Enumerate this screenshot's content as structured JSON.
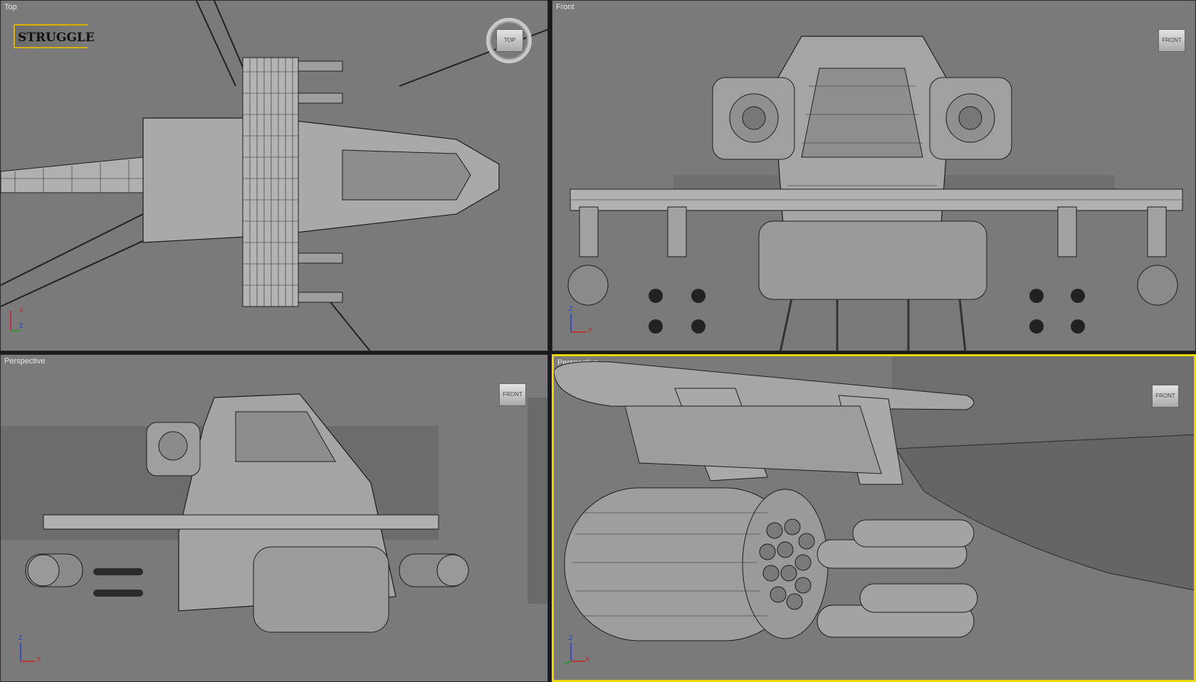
{
  "viewports": {
    "top": {
      "label": "Top"
    },
    "front": {
      "label": "Front"
    },
    "perspective": {
      "label": "Perspective"
    },
    "camera": {
      "label": "Perspective",
      "active": true
    }
  },
  "logo": {
    "text": "STRUGGLE"
  },
  "viewcube": {
    "top": "TOP",
    "front": "FRONT",
    "perspective": "FRONT",
    "camera": "FRONT"
  },
  "axes": {
    "top": {
      "a": "X",
      "b": "Z"
    },
    "front": {
      "a": "Z",
      "b": "X"
    },
    "perspective": {
      "a": "Z",
      "b": "X"
    },
    "camera": {
      "a": "Z",
      "b": "X"
    }
  },
  "colors": {
    "viewport_bg": "#7a7a7a",
    "active_border": "#e8d800",
    "wire": "#1d1d1d",
    "mesh": "#a8a8a8",
    "axis_x": "#d02020",
    "axis_y": "#20a020",
    "axis_z": "#2040d0"
  }
}
